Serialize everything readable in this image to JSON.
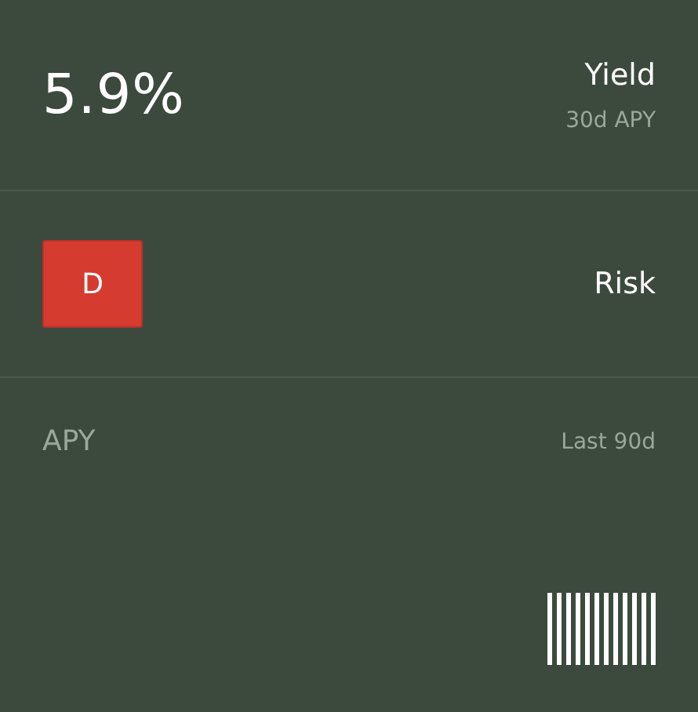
{
  "yield": {
    "value": "5.9%",
    "label": "Yield",
    "sublabel": "30d APY"
  },
  "risk": {
    "grade": "D",
    "label": "Risk"
  },
  "history": {
    "title": "APY",
    "period": "Last 90d"
  }
}
